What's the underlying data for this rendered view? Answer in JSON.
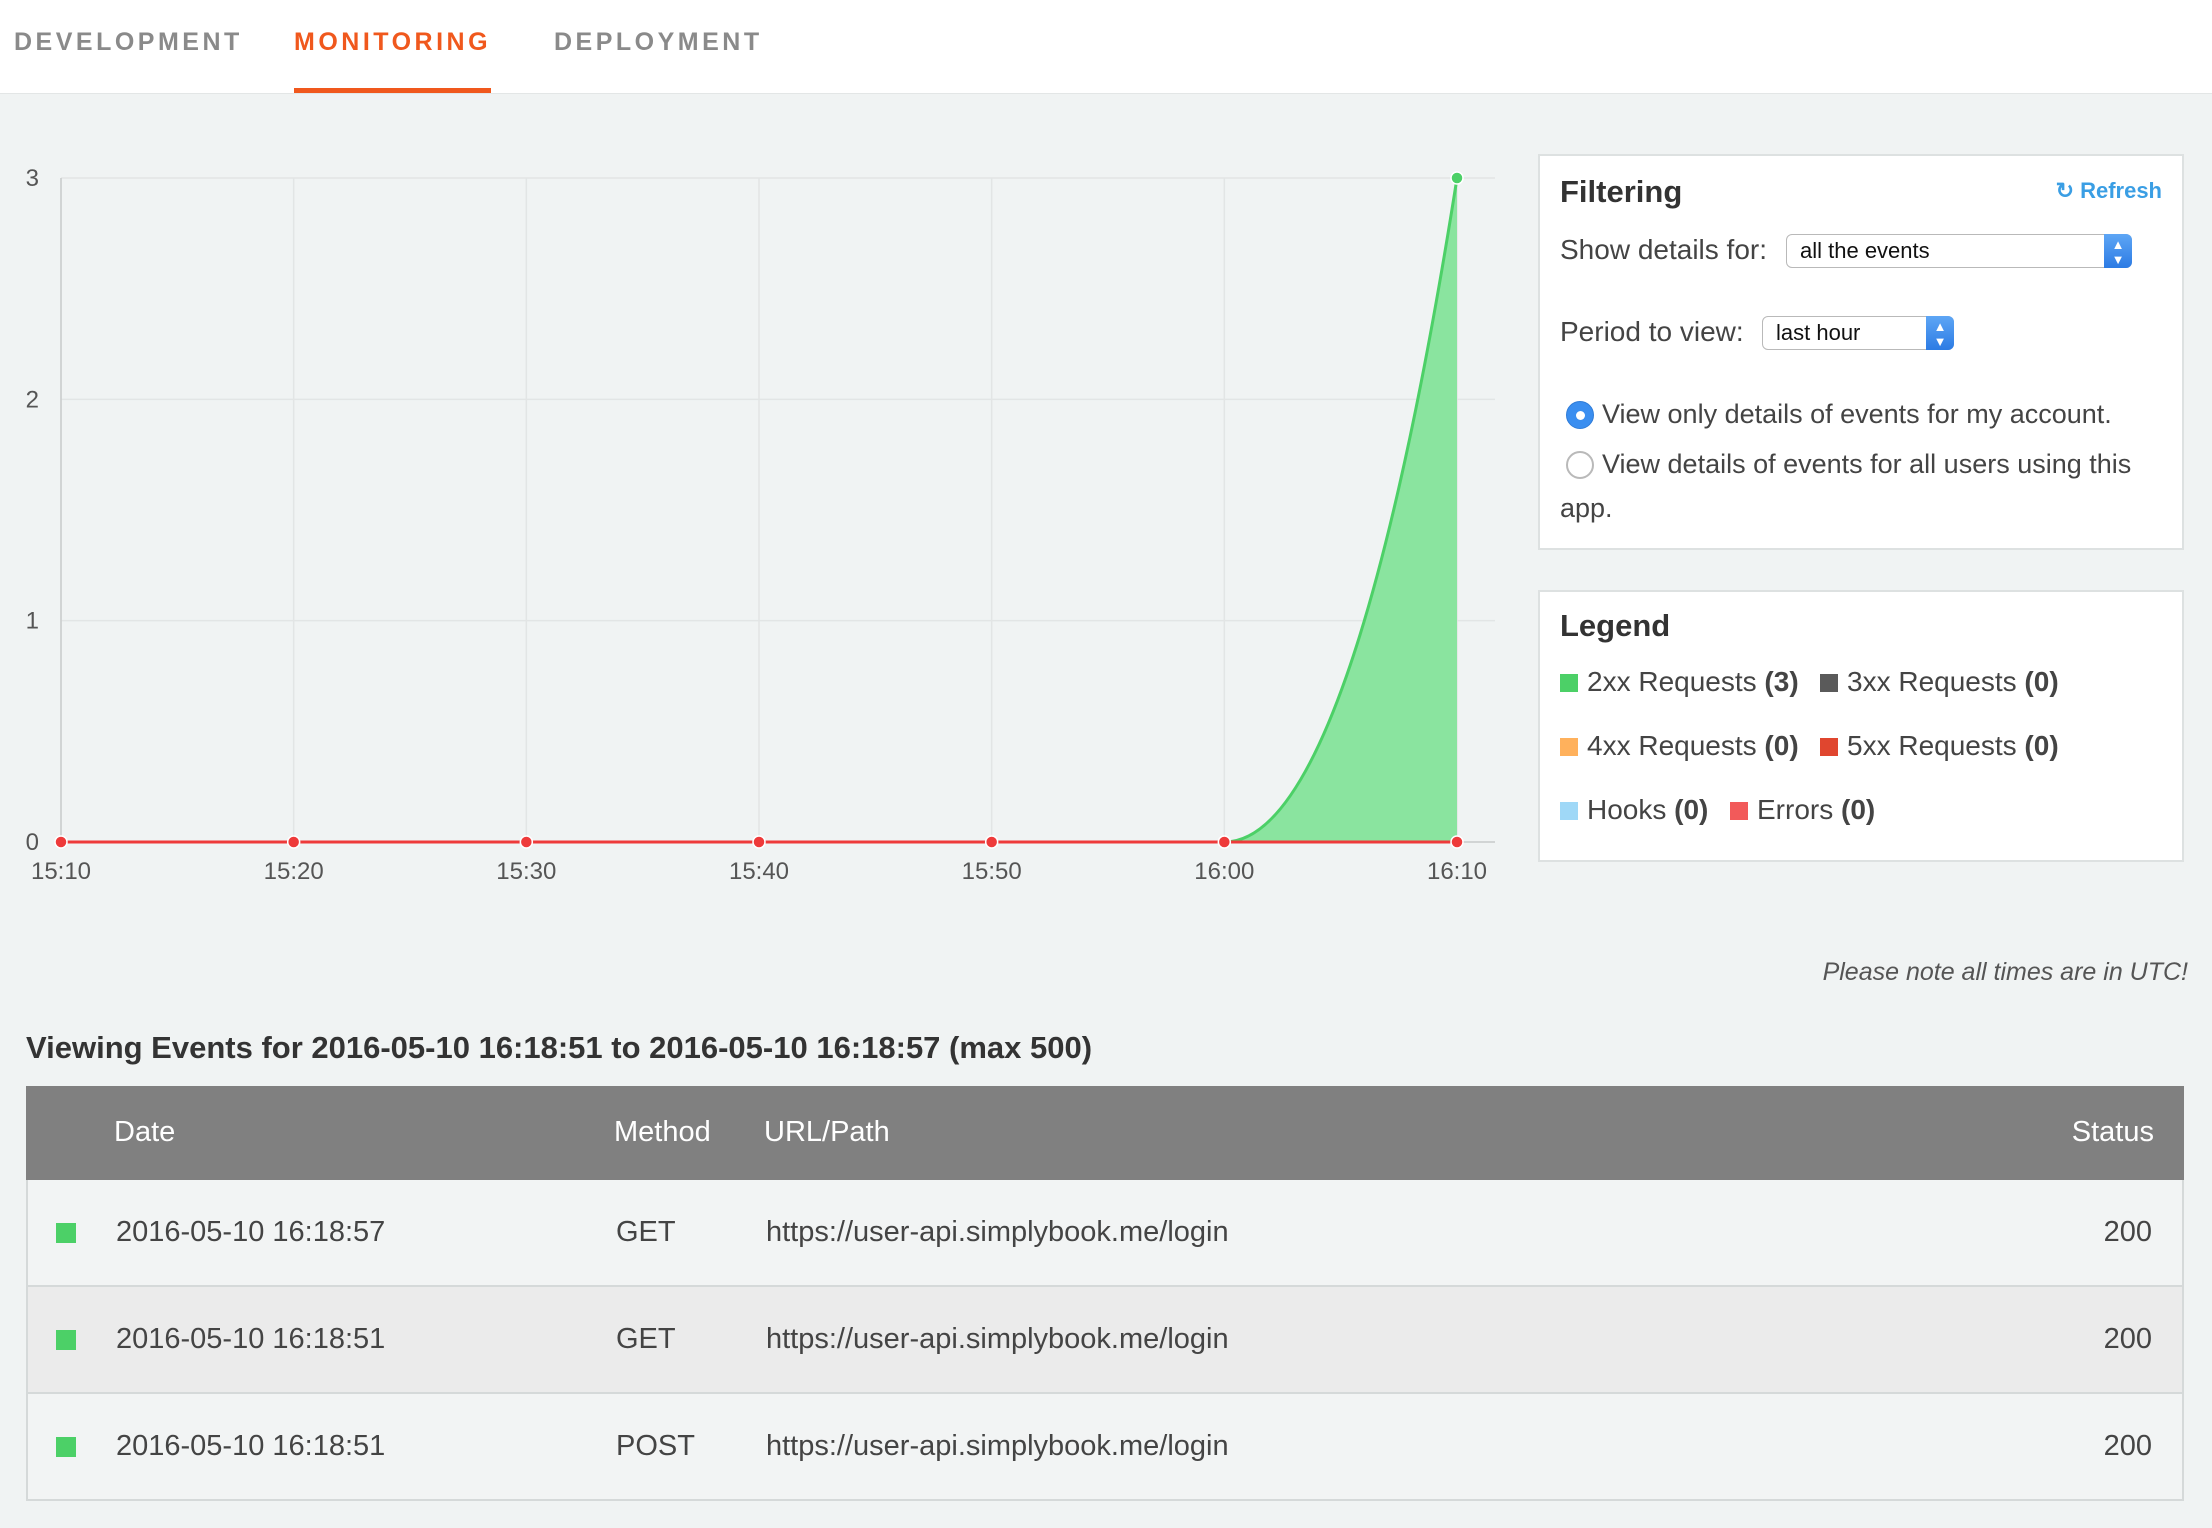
{
  "tabs": [
    {
      "label": "DEVELOPMENT",
      "active": false
    },
    {
      "label": "MONITORING",
      "active": true
    },
    {
      "label": "DEPLOYMENT",
      "active": false
    }
  ],
  "chart_data": {
    "type": "area",
    "title": "",
    "xlabel": "",
    "ylabel": "",
    "categories": [
      "15:10",
      "15:20",
      "15:30",
      "15:40",
      "15:50",
      "16:00",
      "16:10"
    ],
    "y_ticks": [
      0,
      1,
      2,
      3
    ],
    "ylim": [
      0,
      3
    ],
    "grid": true,
    "series": [
      {
        "name": "2xx Requests",
        "color": "#4cd067",
        "values": [
          0,
          0,
          0,
          0,
          0,
          0,
          3
        ]
      },
      {
        "name": "Errors",
        "color": "#ee3a3a",
        "values": [
          0,
          0,
          0,
          0,
          0,
          0,
          0
        ]
      }
    ]
  },
  "filtering": {
    "title": "Filtering",
    "refresh_label": "Refresh",
    "refresh_icon": "refresh-icon",
    "show_details_label": "Show details for:",
    "show_details_value": "all the events",
    "period_label": "Period to view:",
    "period_value": "last hour",
    "radio_own": "View only details of events for my account.",
    "radio_all_line1": "View details of events for all users using this",
    "radio_all_line2": "app.",
    "selected_radio": "own"
  },
  "legend": {
    "title": "Legend",
    "items": [
      {
        "label": "2xx Requests",
        "count": "(3)",
        "color": "#4cd067"
      },
      {
        "label": "3xx Requests",
        "count": "(0)",
        "color": "#5a5a5a"
      },
      {
        "label": "4xx Requests",
        "count": "(0)",
        "color": "#ffb15c"
      },
      {
        "label": "5xx Requests",
        "count": "(0)",
        "color": "#e0462f"
      },
      {
        "label": "Hooks",
        "count": "(0)",
        "color": "#9fd8f7"
      },
      {
        "label": "Errors",
        "count": "(0)",
        "color": "#f25a5a"
      }
    ]
  },
  "note": "Please note all times are in UTC!",
  "events_title": "Viewing Events for 2016-05-10 16:18:51 to 2016-05-10 16:18:57 (max 500)",
  "table": {
    "headers": {
      "date": "Date",
      "method": "Method",
      "url": "URL/Path",
      "status": "Status"
    },
    "rows": [
      {
        "date": "2016-05-10 16:18:57",
        "method": "GET",
        "url": "https://user-api.simplybook.me/login",
        "status": "200",
        "color": "#4cd067"
      },
      {
        "date": "2016-05-10 16:18:51",
        "method": "GET",
        "url": "https://user-api.simplybook.me/login",
        "status": "200",
        "color": "#4cd067"
      },
      {
        "date": "2016-05-10 16:18:51",
        "method": "POST",
        "url": "https://user-api.simplybook.me/login",
        "status": "200",
        "color": "#4cd067"
      }
    ]
  }
}
